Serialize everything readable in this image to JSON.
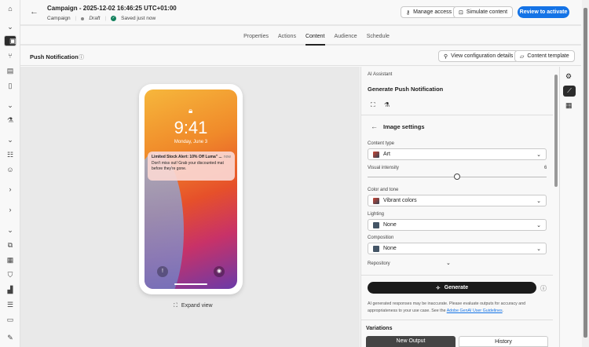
{
  "header": {
    "title": "Campaign - 2025-12-02 16:46:25 UTC+01:00",
    "breadcrumb": "Campaign",
    "status": "Draft",
    "saved": "Saved just now",
    "manage_access": "Manage access",
    "simulate": "Simulate content",
    "review": "Review to activate"
  },
  "tabs": [
    "Properties",
    "Actions",
    "Content",
    "Audience",
    "Schedule"
  ],
  "sub": {
    "title": "Push Notification",
    "view_config": "View configuration details",
    "content_template": "Content template"
  },
  "phone": {
    "time": "9:41",
    "date": "Monday, June 3",
    "notif_title": "Limited Stock Alert: 10% Off Luma\" ...",
    "notif_time": "now",
    "notif_body": "Don't miss out! Grab your discounted mat before they're gone.",
    "expand": "Expand view"
  },
  "panel": {
    "section": "AI Assistant",
    "title": "Generate Push Notification",
    "back_title": "Image settings",
    "content_type_label": "Content type",
    "content_type": "Art",
    "intensity_label": "Visual intensity",
    "intensity": "6",
    "color_label": "Color and tone",
    "color": "Vibrant colors",
    "lighting_label": "Lighting",
    "lighting": "None",
    "composition_label": "Composition",
    "composition": "None",
    "repository_label": "Repository",
    "generate": "Generate",
    "disclaimer": "AI generated responses may be inaccurate. Please evaluate outputs for accuracy and appropriateness to your use case. See the ",
    "guidelines": "Adobe GenAI User Guidelines",
    "variations": "Variations",
    "new_output": "New Output",
    "history": "History"
  },
  "colors": {
    "accent": "#1473e6",
    "dark": "#2c2c2c"
  }
}
